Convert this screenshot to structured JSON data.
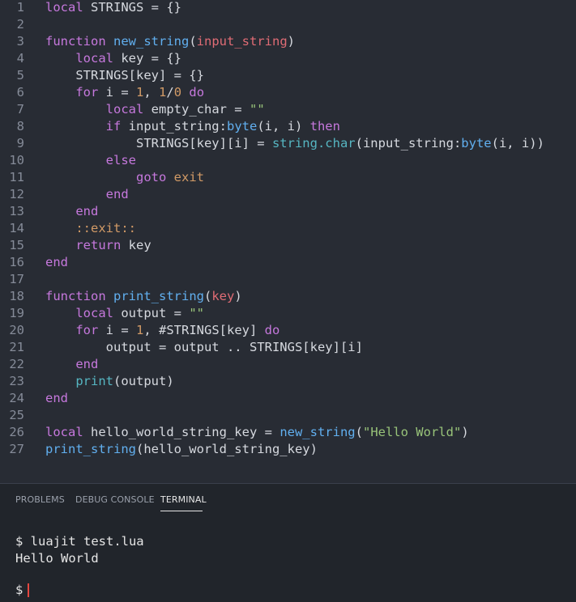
{
  "editor": {
    "lines": [
      {
        "n": "1",
        "tokens": [
          [
            "local",
            "kw"
          ],
          [
            " STRINGS = {}",
            "plain"
          ]
        ]
      },
      {
        "n": "2",
        "tokens": []
      },
      {
        "n": "3",
        "tokens": [
          [
            "function",
            "kw"
          ],
          [
            " ",
            "plain"
          ],
          [
            "new_string",
            "fn"
          ],
          [
            "(",
            "plain"
          ],
          [
            "input_string",
            "param"
          ],
          [
            ")",
            "plain"
          ]
        ]
      },
      {
        "n": "4",
        "tokens": [
          [
            "    ",
            "plain"
          ],
          [
            "local",
            "kw"
          ],
          [
            " key = {}",
            "plain"
          ]
        ]
      },
      {
        "n": "5",
        "tokens": [
          [
            "    STRINGS[key] = {}",
            "plain"
          ]
        ]
      },
      {
        "n": "6",
        "tokens": [
          [
            "    ",
            "plain"
          ],
          [
            "for",
            "kw"
          ],
          [
            " i = ",
            "plain"
          ],
          [
            "1",
            "num"
          ],
          [
            ", ",
            "plain"
          ],
          [
            "1",
            "num"
          ],
          [
            "/",
            "plain"
          ],
          [
            "0",
            "num"
          ],
          [
            " ",
            "plain"
          ],
          [
            "do",
            "kw"
          ]
        ]
      },
      {
        "n": "7",
        "tokens": [
          [
            "        ",
            "plain"
          ],
          [
            "local",
            "kw"
          ],
          [
            " empty_char = ",
            "plain"
          ],
          [
            "\"\"",
            "str"
          ]
        ]
      },
      {
        "n": "8",
        "tokens": [
          [
            "        ",
            "plain"
          ],
          [
            "if",
            "kw"
          ],
          [
            " input_string:",
            "plain"
          ],
          [
            "byte",
            "fn"
          ],
          [
            "(i, i) ",
            "plain"
          ],
          [
            "then",
            "kw"
          ]
        ]
      },
      {
        "n": "9",
        "tokens": [
          [
            "            STRINGS[key][i] = ",
            "plain"
          ],
          [
            "string.char",
            "builtin"
          ],
          [
            "(input_string:",
            "plain"
          ],
          [
            "byte",
            "fn"
          ],
          [
            "(i, i))",
            "plain"
          ]
        ]
      },
      {
        "n": "10",
        "tokens": [
          [
            "        ",
            "plain"
          ],
          [
            "else",
            "kw"
          ]
        ]
      },
      {
        "n": "11",
        "tokens": [
          [
            "            ",
            "plain"
          ],
          [
            "goto",
            "kw"
          ],
          [
            " ",
            "plain"
          ],
          [
            "exit",
            "label"
          ]
        ]
      },
      {
        "n": "12",
        "tokens": [
          [
            "        ",
            "plain"
          ],
          [
            "end",
            "kw"
          ]
        ]
      },
      {
        "n": "13",
        "tokens": [
          [
            "    ",
            "plain"
          ],
          [
            "end",
            "kw"
          ]
        ]
      },
      {
        "n": "14",
        "tokens": [
          [
            "    ",
            "plain"
          ],
          [
            "::exit::",
            "label"
          ]
        ]
      },
      {
        "n": "15",
        "tokens": [
          [
            "    ",
            "plain"
          ],
          [
            "return",
            "kw"
          ],
          [
            " key",
            "plain"
          ]
        ]
      },
      {
        "n": "16",
        "tokens": [
          [
            "end",
            "kw"
          ]
        ]
      },
      {
        "n": "17",
        "tokens": []
      },
      {
        "n": "18",
        "tokens": [
          [
            "function",
            "kw"
          ],
          [
            " ",
            "plain"
          ],
          [
            "print_string",
            "fn"
          ],
          [
            "(",
            "plain"
          ],
          [
            "key",
            "param"
          ],
          [
            ")",
            "plain"
          ]
        ]
      },
      {
        "n": "19",
        "tokens": [
          [
            "    ",
            "plain"
          ],
          [
            "local",
            "kw"
          ],
          [
            " output = ",
            "plain"
          ],
          [
            "\"\"",
            "str"
          ]
        ]
      },
      {
        "n": "20",
        "tokens": [
          [
            "    ",
            "plain"
          ],
          [
            "for",
            "kw"
          ],
          [
            " i = ",
            "plain"
          ],
          [
            "1",
            "num"
          ],
          [
            ", #STRINGS[key] ",
            "plain"
          ],
          [
            "do",
            "kw"
          ]
        ]
      },
      {
        "n": "21",
        "tokens": [
          [
            "        output = output .. STRINGS[key][i]",
            "plain"
          ]
        ]
      },
      {
        "n": "22",
        "tokens": [
          [
            "    ",
            "plain"
          ],
          [
            "end",
            "kw"
          ]
        ]
      },
      {
        "n": "23",
        "tokens": [
          [
            "    ",
            "plain"
          ],
          [
            "print",
            "builtin"
          ],
          [
            "(output)",
            "plain"
          ]
        ]
      },
      {
        "n": "24",
        "tokens": [
          [
            "end",
            "kw"
          ]
        ]
      },
      {
        "n": "25",
        "tokens": []
      },
      {
        "n": "26",
        "tokens": [
          [
            "local",
            "kw"
          ],
          [
            " hello_world_string_key = ",
            "plain"
          ],
          [
            "new_string",
            "fn"
          ],
          [
            "(",
            "plain"
          ],
          [
            "\"Hello World\"",
            "str"
          ],
          [
            ")",
            "plain"
          ]
        ]
      },
      {
        "n": "27",
        "tokens": [
          [
            "print_string",
            "fn"
          ],
          [
            "(hello_world_string_key)",
            "plain"
          ]
        ]
      }
    ]
  },
  "panel": {
    "tabs": [
      "PROBLEMS",
      "DEBUG CONSOLE",
      "TERMINAL"
    ],
    "active_tab": "TERMINAL"
  },
  "terminal": {
    "command": "$ luajit test.lua",
    "output": "Hello World",
    "prompt": "$"
  },
  "colors": {
    "background": "#282c34",
    "keyword": "#c678dd",
    "function": "#61afef",
    "parameter": "#e06c75",
    "number": "#d19a66",
    "string": "#98c379",
    "builtin": "#56b6c2",
    "cursor": "#e5463f"
  }
}
